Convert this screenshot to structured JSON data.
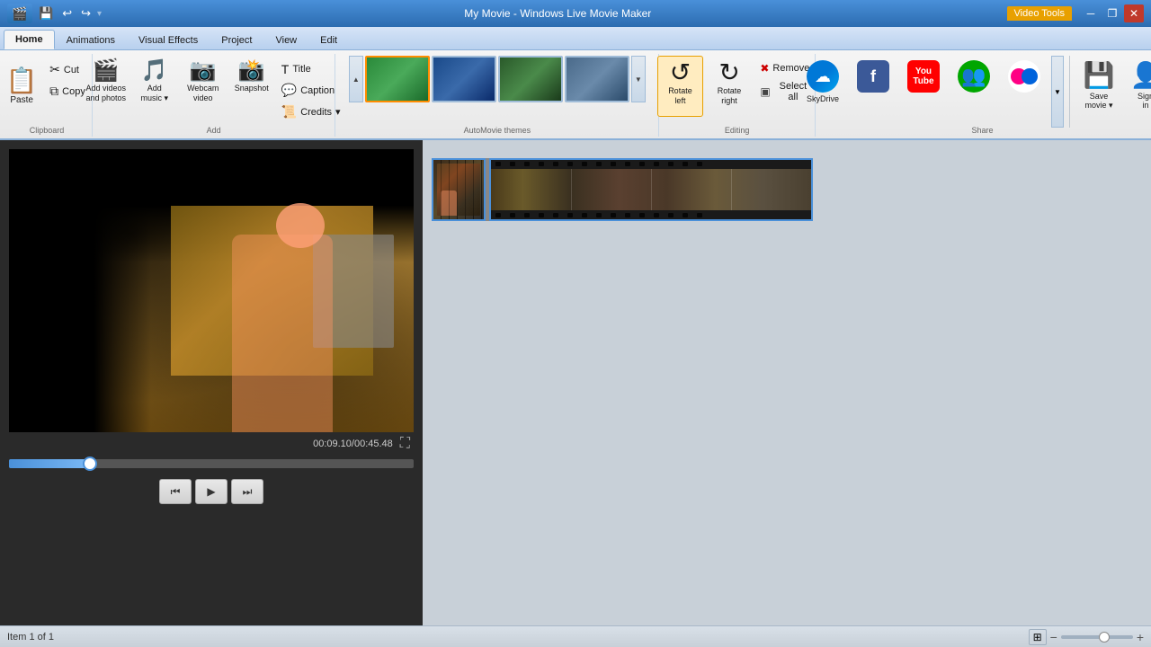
{
  "app": {
    "title": "My Movie - Windows Live Movie Maker",
    "video_tools_badge": "Video Tools"
  },
  "window_controls": {
    "minimize": "─",
    "restore": "❐",
    "close": "✕"
  },
  "ribbon_tabs": {
    "active": "Home",
    "items": [
      "Home",
      "Animations",
      "Visual Effects",
      "Project",
      "View",
      "Edit"
    ]
  },
  "groups": {
    "clipboard": {
      "label": "Clipboard",
      "paste": "Paste",
      "cut": "Cut",
      "copy": "Copy"
    },
    "add": {
      "label": "Add",
      "add_videos": "Add videos\nand photos",
      "add_music": "Add\nmusic",
      "webcam": "Webcam\nvideo",
      "snapshot": "Snapshot",
      "title": "Title",
      "caption": "Caption",
      "credits": "Credits"
    },
    "automovie": {
      "label": "AutoMovie themes"
    },
    "editing": {
      "label": "Editing",
      "rotate_left": "Rotate\nleft",
      "rotate_right": "Rotate\nright",
      "remove": "Remove",
      "select_all": "Select all"
    },
    "share": {
      "label": "Share",
      "skydrive": "SkyDrive",
      "facebook": "Facebook",
      "youtube": "YouTube",
      "messenger": "Messenger",
      "flickr": "Flickr",
      "save_movie": "Save\nmovie",
      "sign_in": "Sign\nin"
    }
  },
  "player": {
    "time": "00:09.10/00:45.48",
    "progress_pct": 20
  },
  "status": {
    "item": "Item 1 of 1"
  }
}
